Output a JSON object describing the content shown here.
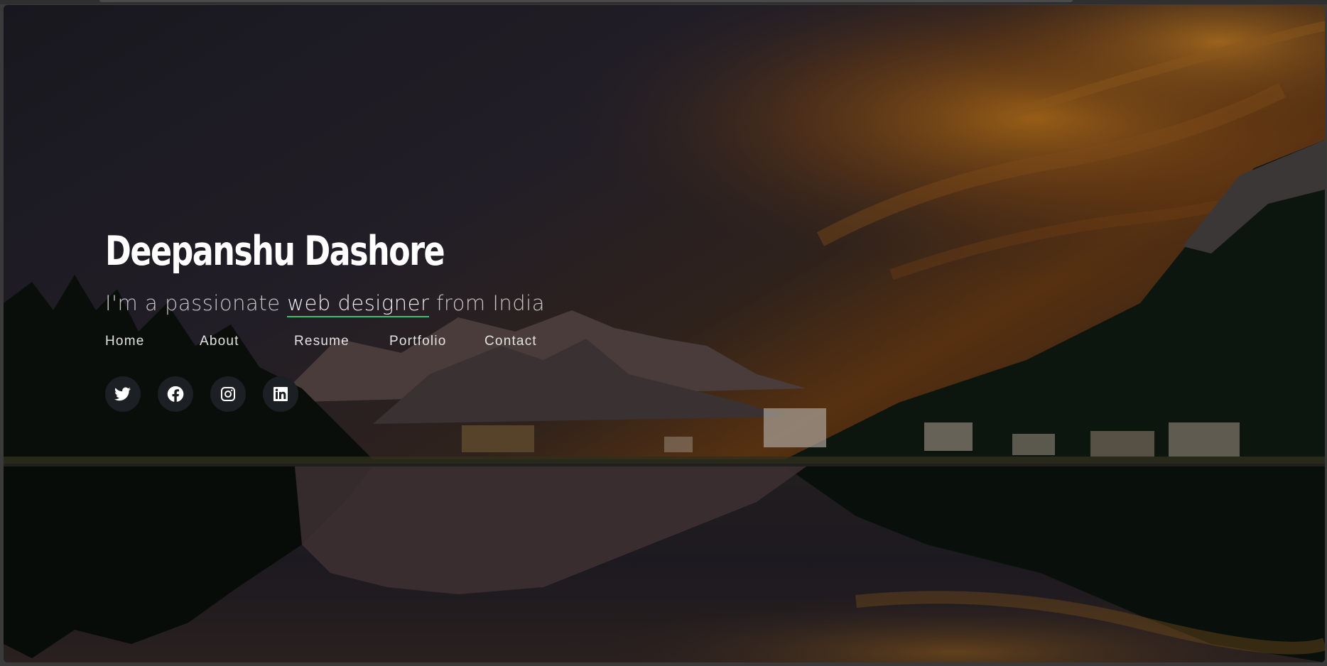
{
  "hero": {
    "name": "Deepanshu Dashore",
    "tagline_prefix": "I'm a passionate ",
    "tagline_highlight": "web designer",
    "tagline_suffix": " from India"
  },
  "nav": {
    "items": [
      {
        "label": "Home"
      },
      {
        "label": "About"
      },
      {
        "label": "Resume"
      },
      {
        "label": "Portfolio"
      },
      {
        "label": "Contact"
      }
    ]
  },
  "social": {
    "icons": [
      "twitter-icon",
      "facebook-icon",
      "instagram-icon",
      "linkedin-icon"
    ]
  },
  "colors": {
    "accent_underline": "#2fd37a",
    "text": "#ffffff",
    "social_bg": "#1c1f24"
  }
}
